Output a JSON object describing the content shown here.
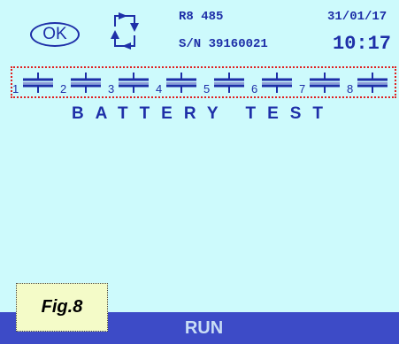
{
  "header": {
    "ok_label": "OK",
    "model": "R8 485",
    "serial": "S/N 39160021",
    "date": "31/01/17",
    "time": "10:17"
  },
  "cells": [
    {
      "number": "1"
    },
    {
      "number": "2"
    },
    {
      "number": "3"
    },
    {
      "number": "4"
    },
    {
      "number": "5"
    },
    {
      "number": "6"
    },
    {
      "number": "7"
    },
    {
      "number": "8"
    }
  ],
  "main": {
    "title": "BATTERY TEST"
  },
  "status_bar": {
    "label": "RUN"
  },
  "figure": {
    "label": "Fig.8"
  },
  "colors": {
    "screen_bg": "#cdfafc",
    "text_blue": "#1e2fa8",
    "status_bar": "#3d4bc7",
    "highlight_border": "#e02020"
  }
}
